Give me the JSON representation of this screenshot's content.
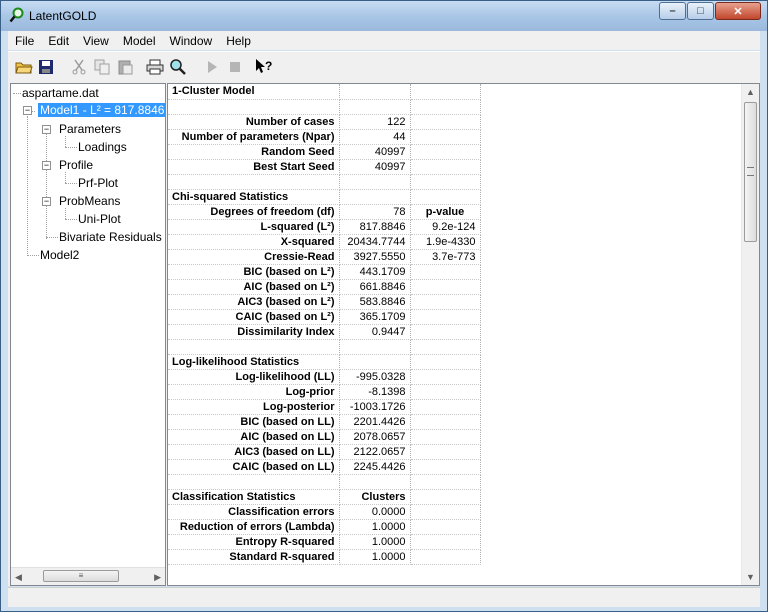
{
  "window": {
    "title": "LatentGOLD"
  },
  "menu": [
    "File",
    "Edit",
    "View",
    "Model",
    "Window",
    "Help"
  ],
  "toolbar": [
    {
      "icon": "open-folder-icon"
    },
    {
      "icon": "save-icon"
    },
    {
      "icon": "cut-icon"
    },
    {
      "icon": "copy-icon"
    },
    {
      "icon": "paste-icon"
    },
    {
      "icon": "print-icon"
    },
    {
      "icon": "search-model-icon"
    },
    {
      "icon": "run-icon"
    },
    {
      "icon": "stop-icon"
    },
    {
      "icon": "context-help-icon"
    }
  ],
  "tree": {
    "file": "aspartame.dat",
    "model1": "Model1 - L² = 817.8846",
    "parameters": "Parameters",
    "loadings": "Loadings",
    "profile": "Profile",
    "prf_plot": "Prf-Plot",
    "probmeans": "ProbMeans",
    "uni_plot": "Uni-Plot",
    "bivariate": "Bivariate Residuals",
    "model2": "Model2"
  },
  "output": {
    "rows": [
      {
        "label": "1-Cluster Model",
        "v1": "",
        "v2": "",
        "section": true
      },
      {
        "label": "",
        "v1": "",
        "v2": ""
      },
      {
        "label": "Number of cases",
        "v1": "122",
        "v2": ""
      },
      {
        "label": "Number of parameters (Npar)",
        "v1": "44",
        "v2": ""
      },
      {
        "label": "Random Seed",
        "v1": "40997",
        "v2": ""
      },
      {
        "label": "Best Start Seed",
        "v1": "40997",
        "v2": ""
      },
      {
        "label": "",
        "v1": "",
        "v2": ""
      },
      {
        "label": "Chi-squared Statistics",
        "v1": "",
        "v2": "",
        "section": true
      },
      {
        "label": "Degrees of freedom (df)",
        "v1": "78",
        "v2": "p-value",
        "v2hdr": true
      },
      {
        "label": "L-squared (L²)",
        "v1": "817.8846",
        "v2": "9.2e-124"
      },
      {
        "label": "X-squared",
        "v1": "20434.7744",
        "v2": "1.9e-4330"
      },
      {
        "label": "Cressie-Read",
        "v1": "3927.5550",
        "v2": "3.7e-773"
      },
      {
        "label": "BIC (based on L²)",
        "v1": "443.1709",
        "v2": ""
      },
      {
        "label": "AIC (based on L²)",
        "v1": "661.8846",
        "v2": ""
      },
      {
        "label": "AIC3 (based on L²)",
        "v1": "583.8846",
        "v2": ""
      },
      {
        "label": "CAIC (based on L²)",
        "v1": "365.1709",
        "v2": ""
      },
      {
        "label": "Dissimilarity Index",
        "v1": "0.9447",
        "v2": ""
      },
      {
        "label": "",
        "v1": "",
        "v2": ""
      },
      {
        "label": "Log-likelihood Statistics",
        "v1": "",
        "v2": "",
        "section": true
      },
      {
        "label": "Log-likelihood (LL)",
        "v1": "-995.0328",
        "v2": ""
      },
      {
        "label": "Log-prior",
        "v1": "-8.1398",
        "v2": ""
      },
      {
        "label": "Log-posterior",
        "v1": "-1003.1726",
        "v2": ""
      },
      {
        "label": "BIC (based on LL)",
        "v1": "2201.4426",
        "v2": ""
      },
      {
        "label": "AIC (based on LL)",
        "v1": "2078.0657",
        "v2": ""
      },
      {
        "label": "AIC3 (based on LL)",
        "v1": "2122.0657",
        "v2": ""
      },
      {
        "label": "CAIC (based on LL)",
        "v1": "2245.4426",
        "v2": ""
      },
      {
        "label": "",
        "v1": "",
        "v2": ""
      },
      {
        "label": "Classification Statistics",
        "v1": "Clusters",
        "v2": "",
        "section": true,
        "v1hdr": true
      },
      {
        "label": "Classification errors",
        "v1": "0.0000",
        "v2": ""
      },
      {
        "label": "Reduction of errors (Lambda)",
        "v1": "1.0000",
        "v2": ""
      },
      {
        "label": "Entropy R-squared",
        "v1": "1.0000",
        "v2": ""
      },
      {
        "label": "Standard R-squared",
        "v1": "1.0000",
        "v2": ""
      }
    ]
  },
  "colors": {
    "selection": "#3399ff",
    "frame": "#cfe0f1"
  }
}
